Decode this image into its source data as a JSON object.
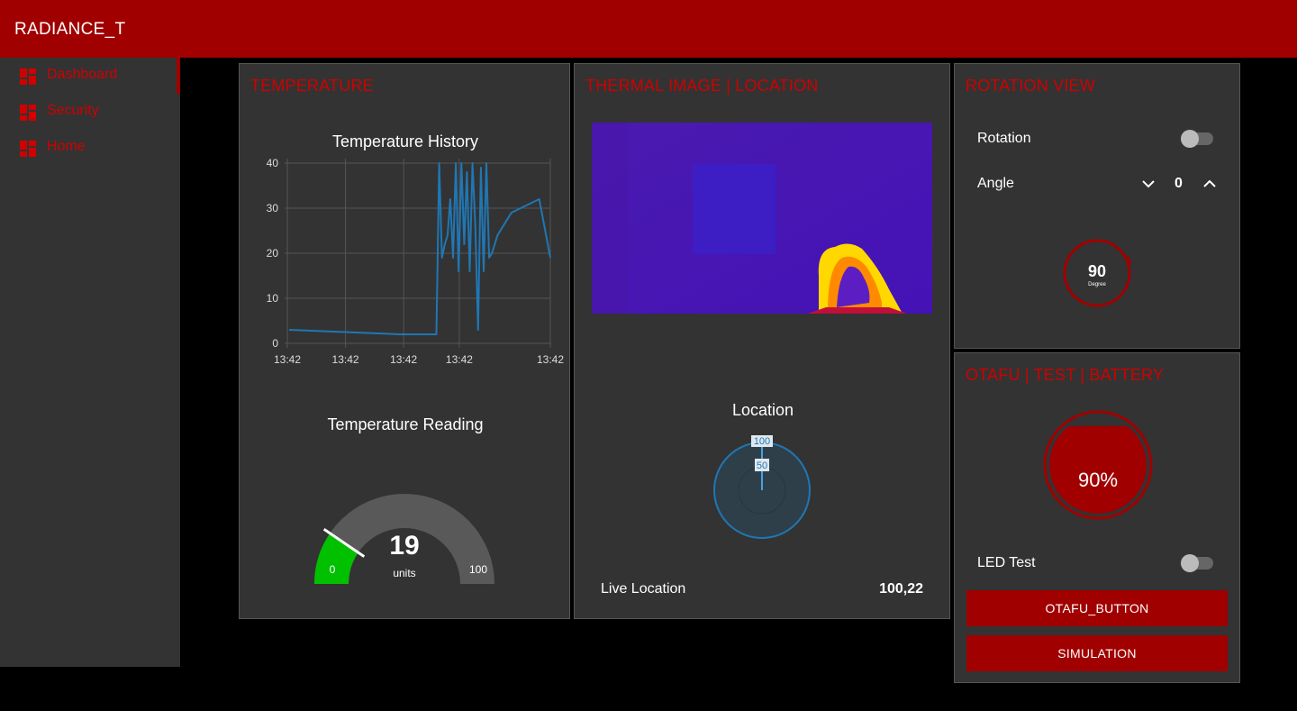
{
  "app": {
    "title": "RADIANCE_T"
  },
  "sidebar": {
    "items": [
      {
        "label": "Dashboard",
        "icon": "dashboard-icon"
      },
      {
        "label": "Security",
        "icon": "dashboard-icon"
      },
      {
        "label": "Home",
        "icon": "dashboard-icon"
      }
    ]
  },
  "temperature": {
    "card_title": "TEMPERATURE",
    "history_title": "Temperature History",
    "reading_title": "Temperature Reading",
    "gauge": {
      "value": "19",
      "units": "units",
      "min": "0",
      "max": "100",
      "fraction": 0.19
    }
  },
  "thermal": {
    "card_title": "THERMAL IMAGE | LOCATION",
    "location_title": "Location",
    "radar_labels": [
      "100",
      "50"
    ],
    "live_location_label": "Live Location",
    "live_location_value": "100,22"
  },
  "rotation": {
    "card_title": "ROTATION VIEW",
    "rotation_label": "Rotation",
    "angle_label": "Angle",
    "angle_value": "0",
    "dial_value": "90",
    "dial_unit": "Degree"
  },
  "otafu": {
    "card_title": "OTAFU | TEST | BATTERY",
    "battery_value": "90%",
    "battery_level": 0.9,
    "led_label": "LED Test",
    "otafu_button": "OTAFU_BUTTON",
    "simulation_button": "SIMULATION"
  },
  "colors": {
    "accent": "#a00000",
    "title_red": "#d00000",
    "card": "#333333",
    "series": "#1f77b4",
    "gauge_green": "#00c000"
  },
  "chart_data": {
    "type": "line",
    "title": "Temperature History",
    "xlabel": "",
    "ylabel": "",
    "ylim": [
      0,
      40
    ],
    "yticks": [
      "0",
      "10",
      "20",
      "30",
      "40"
    ],
    "xtick_labels": [
      "13:42",
      "13:42",
      "13:42",
      "13:42",
      "13:42"
    ],
    "grid": true,
    "x": [
      0,
      20,
      26.5,
      27.0,
      27.5,
      28.0,
      28.5,
      29.0,
      29.5,
      30.0,
      30.5,
      31.0,
      31.5,
      32.0,
      32.5,
      33.0,
      33.5,
      34.0,
      34.5,
      35.0,
      35.5,
      36.0,
      36.5,
      37.0,
      37.5,
      38.0,
      39.0,
      40.0,
      45.0,
      47.0
    ],
    "y": [
      3,
      2,
      2,
      40,
      19,
      22,
      24,
      32,
      19,
      40,
      16,
      40,
      22,
      38,
      16,
      40,
      26,
      3,
      39,
      16,
      40,
      19,
      20,
      22,
      24,
      25,
      27,
      29,
      32,
      19
    ]
  }
}
